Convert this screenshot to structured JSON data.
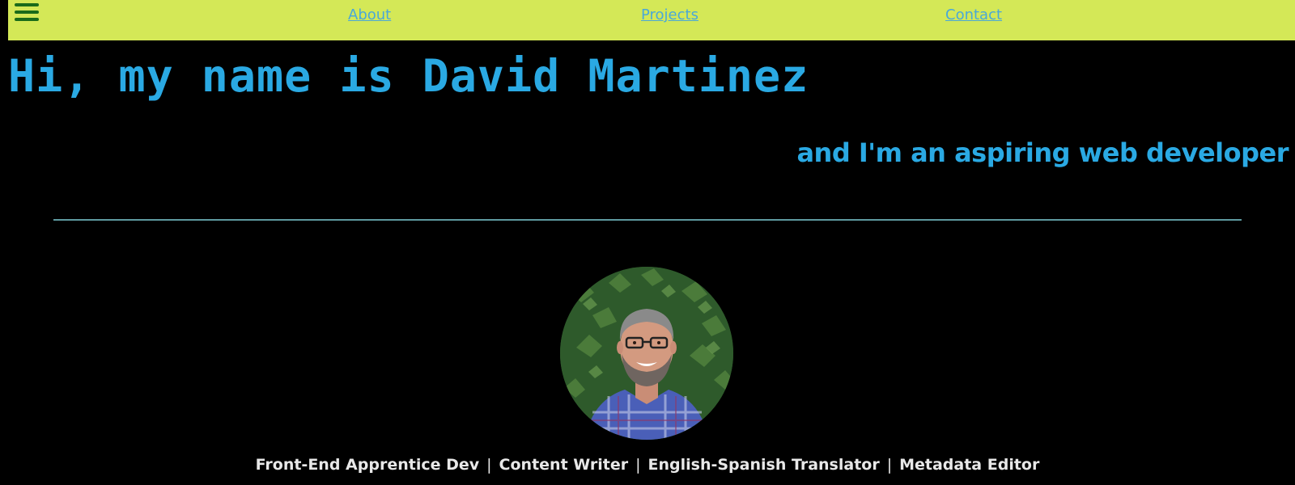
{
  "nav": {
    "menu_icon": "hamburger-menu-icon",
    "links": [
      {
        "label": "About"
      },
      {
        "label": "Projects"
      },
      {
        "label": "Contact"
      }
    ]
  },
  "hero": {
    "title": "Hi, my name is David Martinez",
    "subtitle": "and I'm an aspiring web developer"
  },
  "profile": {
    "roles": [
      "Front-End Apprentice Dev",
      "Content Writer",
      "English-Spanish Translator",
      "Metadata Editor"
    ],
    "separator": "|"
  },
  "colors": {
    "background": "#000000",
    "navbar": "#d4e857",
    "accent_blue": "#2aa9e3",
    "link_blue": "#4aa8d8",
    "menu_icon": "#1a6b1a",
    "divider": "#5e9aa0",
    "roles_text": "#e8e8e8"
  }
}
